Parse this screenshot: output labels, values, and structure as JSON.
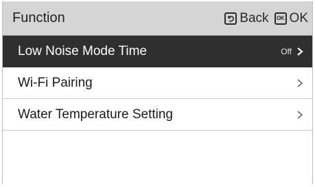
{
  "header": {
    "title": "Function",
    "back_label": "Back",
    "ok_icon_text": "OK",
    "ok_label": "OK"
  },
  "menu": {
    "items": [
      {
        "label": "Low Noise Mode Time",
        "value": "Off",
        "selected": true
      },
      {
        "label": "Wi-Fi Pairing",
        "value": "",
        "selected": false
      },
      {
        "label": "Water Temperature Setting",
        "value": "",
        "selected": false
      }
    ]
  },
  "icons": {
    "back": "back-icon",
    "ok": "ok-icon",
    "chevron": "chevron-right-icon"
  },
  "colors": {
    "header_bg": "#d5d5d5",
    "selected_bg": "#2f2f2f",
    "text": "#1a1a1a"
  }
}
